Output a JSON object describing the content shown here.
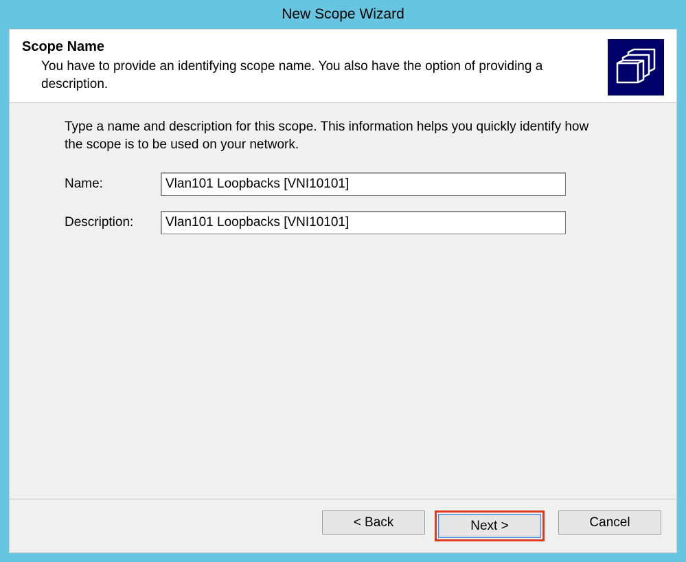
{
  "titlebar": {
    "title": "New Scope Wizard"
  },
  "header": {
    "title": "Scope Name",
    "description": "You have to provide an identifying scope name. You also have the option of providing a description."
  },
  "body": {
    "intro": "Type a name and description for this scope. This information helps you quickly identify how the scope is to be used on your network.",
    "name_label": "Name:",
    "name_value": "Vlan101 Loopbacks [VNI10101]",
    "description_label": "Description:",
    "description_value": "Vlan101 Loopbacks [VNI10101]"
  },
  "footer": {
    "back": "< Back",
    "next": "Next >",
    "cancel": "Cancel"
  }
}
